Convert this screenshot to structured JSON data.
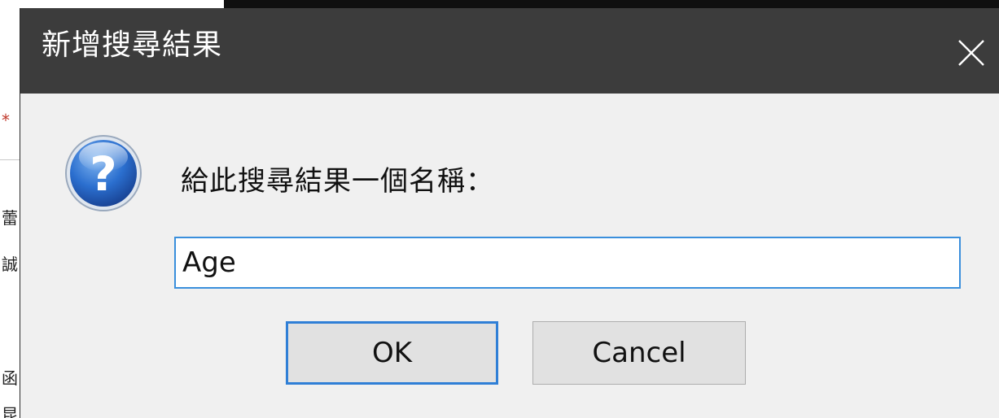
{
  "background": {
    "fragments": [
      "*",
      "蕾",
      "誠",
      "函",
      "昆"
    ]
  },
  "dialog": {
    "title": "新增搜尋結果",
    "close_glyph": "✕",
    "icon": "question-mark-icon",
    "prompt": "給此搜尋結果一個名稱：",
    "input_value": "Age",
    "ok_label": "OK",
    "cancel_label": "Cancel"
  },
  "colors": {
    "titlebar": "#3c3c3c",
    "dialog_bg": "#f0f0f0",
    "focus_border": "#2f7fd6",
    "icon_blue": "#1f5fb8"
  }
}
